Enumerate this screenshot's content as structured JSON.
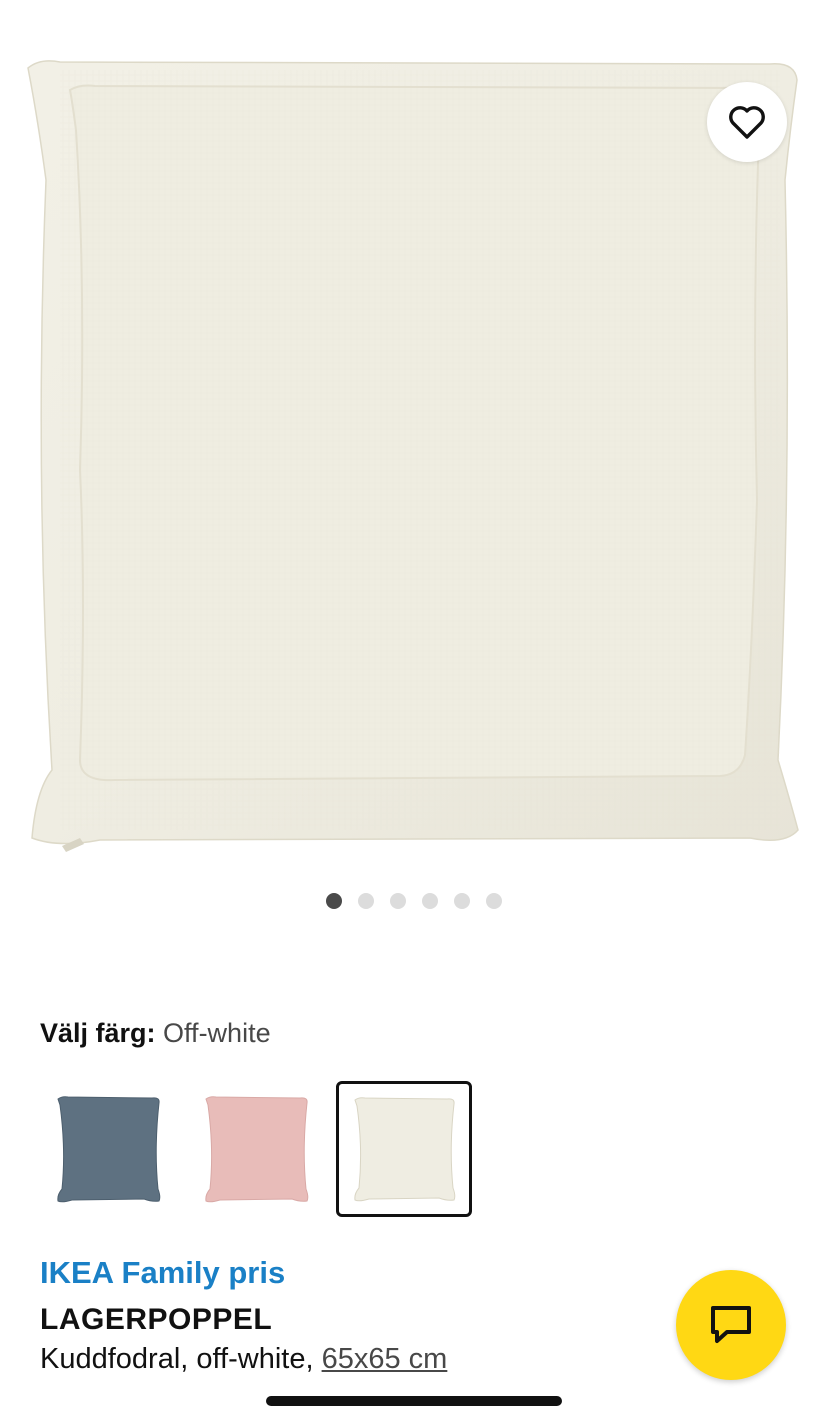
{
  "product_image": {
    "icon": "cushion-cover-off-white-image",
    "fabric_color": "#efede2"
  },
  "favourite": {
    "icon": "heart-outline-icon"
  },
  "carousel": {
    "total": 6,
    "active_index": 1
  },
  "color_picker": {
    "label": "Välj färg:",
    "selected_value": "Off-white",
    "options": [
      {
        "name": "dark-blue-grey",
        "color": "#5e7181",
        "selected": false
      },
      {
        "name": "pink",
        "color": "#e8bcb9",
        "selected": false
      },
      {
        "name": "off-white",
        "color": "#efede2",
        "selected": true
      }
    ]
  },
  "product": {
    "family_price_label": "IKEA Family pris",
    "name": "LAGERPOPPEL",
    "description": "Kuddfodral, off-white,",
    "size": "65x65 cm"
  },
  "chat": {
    "icon": "chat-bubble-icon",
    "color": "#ffd814"
  },
  "colors": {
    "family_blue": "#1a80c6",
    "text": "#111111"
  }
}
